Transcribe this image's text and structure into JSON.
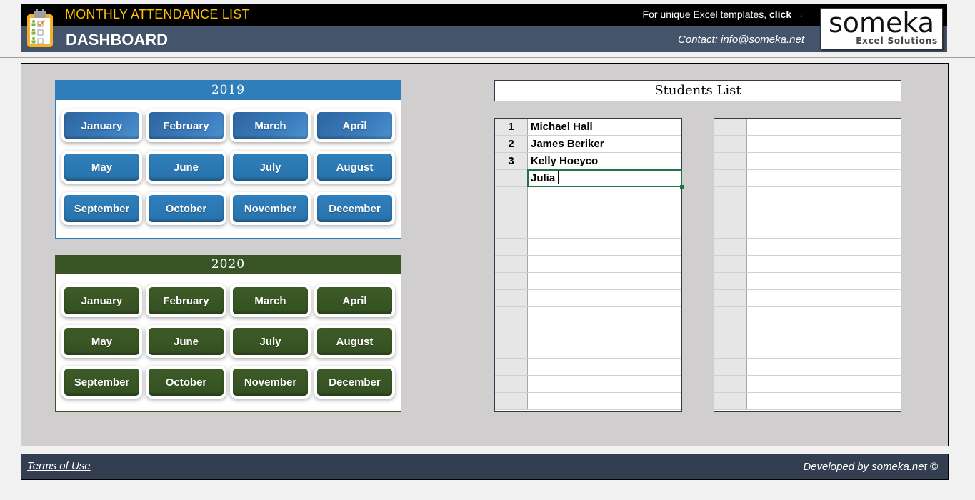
{
  "header": {
    "app_title": "MONTHLY ATTENDANCE LIST",
    "page_title": "DASHBOARD",
    "promo_text": "For unique Excel templates, ",
    "promo_link": "click →",
    "contact": "Contact: info@someka.net",
    "logo_brand": "someka",
    "logo_tagline": "Excel Solutions",
    "colors": {
      "title": "#ffc000",
      "bar_top": "#000000",
      "bar_bottom": "#44546a"
    }
  },
  "calendar_2019": {
    "year": "2019",
    "color": "#2e7ebb",
    "months": [
      "January",
      "February",
      "March",
      "April",
      "May",
      "June",
      "July",
      "August",
      "September",
      "October",
      "November",
      "December"
    ]
  },
  "calendar_2020": {
    "year": "2020",
    "color": "#3a5525",
    "months": [
      "January",
      "February",
      "March",
      "April",
      "May",
      "June",
      "July",
      "August",
      "September",
      "October",
      "November",
      "December"
    ]
  },
  "students": {
    "title": "Students List",
    "list1": [
      {
        "num": "1",
        "name": "Michael Hall"
      },
      {
        "num": "2",
        "name": "James Beriker"
      },
      {
        "num": "3",
        "name": "Kelly Hoeyco"
      },
      {
        "num": "",
        "name": "Julia",
        "editing": true
      },
      {
        "num": "",
        "name": ""
      },
      {
        "num": "",
        "name": ""
      },
      {
        "num": "",
        "name": ""
      },
      {
        "num": "",
        "name": ""
      },
      {
        "num": "",
        "name": ""
      },
      {
        "num": "",
        "name": ""
      },
      {
        "num": "",
        "name": ""
      },
      {
        "num": "",
        "name": ""
      },
      {
        "num": "",
        "name": ""
      },
      {
        "num": "",
        "name": ""
      },
      {
        "num": "",
        "name": ""
      },
      {
        "num": "",
        "name": ""
      },
      {
        "num": "",
        "name": ""
      }
    ],
    "list2": [
      {
        "num": "",
        "name": ""
      },
      {
        "num": "",
        "name": ""
      },
      {
        "num": "",
        "name": ""
      },
      {
        "num": "",
        "name": ""
      },
      {
        "num": "",
        "name": ""
      },
      {
        "num": "",
        "name": ""
      },
      {
        "num": "",
        "name": ""
      },
      {
        "num": "",
        "name": ""
      },
      {
        "num": "",
        "name": ""
      },
      {
        "num": "",
        "name": ""
      },
      {
        "num": "",
        "name": ""
      },
      {
        "num": "",
        "name": ""
      },
      {
        "num": "",
        "name": ""
      },
      {
        "num": "",
        "name": ""
      },
      {
        "num": "",
        "name": ""
      },
      {
        "num": "",
        "name": ""
      },
      {
        "num": "",
        "name": ""
      }
    ]
  },
  "footer": {
    "terms": "Terms of Use",
    "developed_by": "Developed by someka.net ©"
  }
}
